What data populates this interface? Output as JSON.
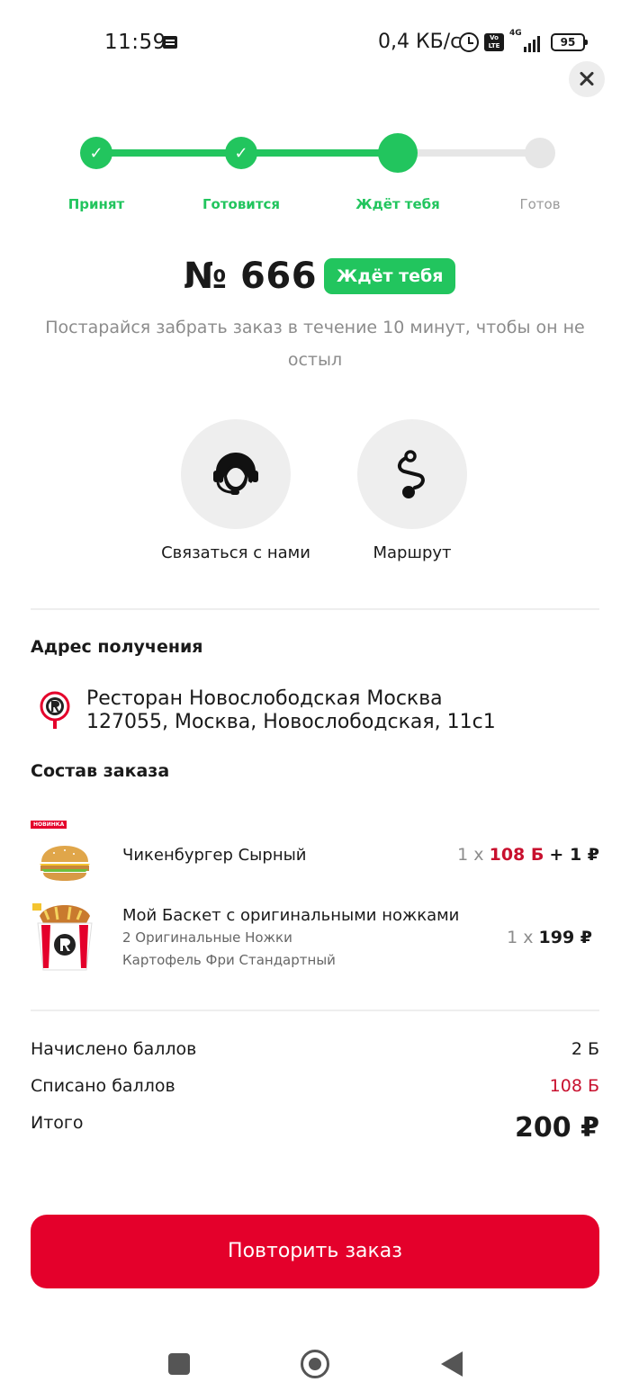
{
  "status_bar": {
    "time": "11:59",
    "speed": "0,4 КБ/с",
    "volte": "Vo LTE",
    "network": "4G",
    "battery": "95"
  },
  "progress": {
    "steps": [
      {
        "label": "Принят",
        "state": "done"
      },
      {
        "label": "Готовится",
        "state": "done"
      },
      {
        "label": "Ждёт тебя",
        "state": "current"
      },
      {
        "label": "Готов",
        "state": "pending"
      }
    ],
    "check_glyph": "✓"
  },
  "order": {
    "number": "№ 666",
    "status": "Ждёт тебя",
    "hint": "Постарайся забрать заказ в течение 10 минут, чтобы он не остыл"
  },
  "actions": {
    "contact_label": "Связаться с нами",
    "route_label": "Маршрут"
  },
  "pickup": {
    "title": "Адрес получения",
    "restaurant": "Ресторан Новослободская Москва",
    "address": "127055, Москва, Новослободская, 11с1"
  },
  "items_section": {
    "title": "Состав заказа",
    "new_badge": "НОВИНКА",
    "items": [
      {
        "name": "Чикенбургер Сырный",
        "qty": "1 x",
        "points": "108 Б",
        "extra": "+ 1 ₽"
      },
      {
        "name": "Мой Баскет с оригинальными ножками",
        "sub1": "2 Оригинальные Ножки",
        "sub2": "Картофель Фри Стандартный",
        "qty": "1 x",
        "price": "199 ₽"
      }
    ]
  },
  "totals": {
    "earned_label": "Начислено баллов",
    "earned_value": "2 Б",
    "spent_label": "Списано баллов",
    "spent_value": "108 Б",
    "total_label": "Итого",
    "total_value": "200 ₽"
  },
  "repeat_button": "Повторить заказ",
  "colors": {
    "accent_green": "#22c55e",
    "brand_red": "#e4002b",
    "points_red": "#c8102e"
  }
}
